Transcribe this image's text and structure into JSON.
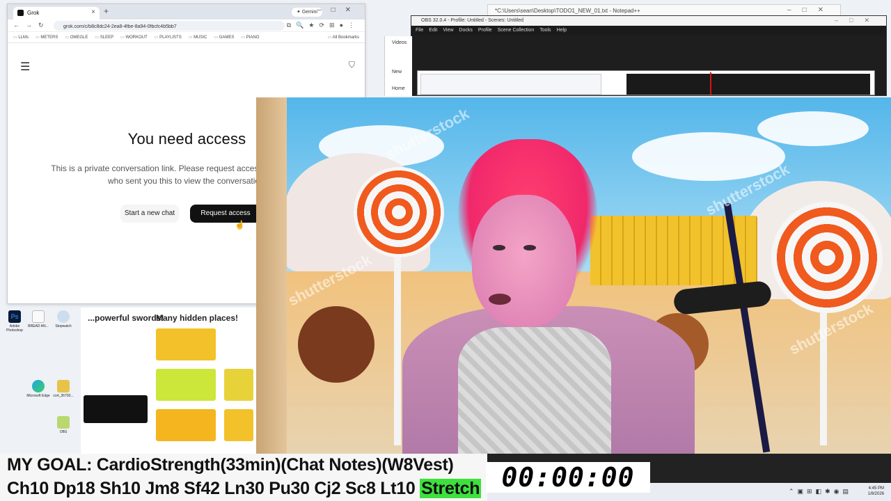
{
  "browser": {
    "tab_title": "Grok",
    "gemini_label": "Gemini",
    "url": "grok.com/c/b8c8dc24-2ea8-4fbe-8a94-0fbcfc4b5bb7",
    "bookmarks": [
      "LLMs",
      "METERS",
      "OMEGLE",
      "SLEEP",
      "WORKOUT",
      "PLAYLISTS",
      "MUSIC",
      "GAMES",
      "PIANO"
    ],
    "all_bookmarks": "All Bookmarks"
  },
  "page": {
    "title": "You need access",
    "body_line1": "This is a private conversation link. Please request access from the person",
    "body_line2": "who sent you this to view the conversation.",
    "start_new_chat": "Start a new chat",
    "request_access": "Request access"
  },
  "notepad": {
    "title": "*C:\\Users\\sean\\Desktop\\TODO1_NEW_01.txt - Notepad++"
  },
  "obs": {
    "title": "OBS 32.0.4 - Profile: Untitled - Scenes: Untitled",
    "menu": [
      "File",
      "Edit",
      "View",
      "Docks",
      "Profile",
      "Scene Collection",
      "Tools",
      "Help"
    ]
  },
  "bg_chrome": {
    "rows": [
      "Videos",
      "New",
      "Home"
    ]
  },
  "infographic": {
    "heading_left": "...powerful swords!",
    "heading_right": "Many hidden places!"
  },
  "desktop_icons": [
    "Adobe Photoshop",
    "BREAD AN...",
    "Stopwatch",
    "Microsoft Edge",
    "cort_36793...",
    "OBS"
  ],
  "watermark": "shutterstock",
  "ticker": {
    "goal": "MY GOAL: CardioStrength(33min)(Chat Notes)(W8Vest)",
    "stats": "Ch10 Dp18 Sh10 Jm8 Sf42 Ln30 Pu30 Cj2 Sc8 Lt10",
    "highlight": "Stretch"
  },
  "timer": "00:00:00",
  "clock": {
    "time": "4:45 PM",
    "date": "1/8/2026"
  },
  "colors": {
    "highlight": "#3ee03e",
    "hair": "#f0286b",
    "sky": "#54b6ea"
  }
}
